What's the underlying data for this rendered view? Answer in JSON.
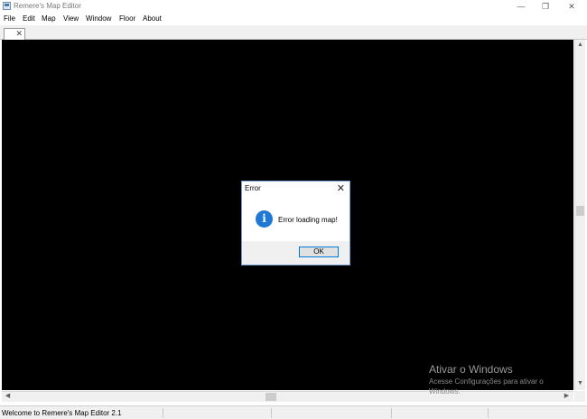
{
  "window": {
    "title": "Remere's Map Editor",
    "controls": {
      "minimize": "—",
      "maximize": "❐",
      "close": "✕"
    }
  },
  "menubar": {
    "items": [
      "File",
      "Edit",
      "Map",
      "View",
      "Window",
      "Floor",
      "About"
    ]
  },
  "tabs": [
    {
      "label": "",
      "close_icon": "✕"
    }
  ],
  "dialog": {
    "title": "Error",
    "close_icon": "✕",
    "icon": "info-icon",
    "icon_glyph": "i",
    "message": "Error loading map!",
    "ok_label": "OK"
  },
  "scrollbars": {
    "up": "▲",
    "down": "▼",
    "left": "◀",
    "right": "▶"
  },
  "statusbar": {
    "text": "Welcome to Remere's Map Editor 2.1"
  },
  "watermark": {
    "title": "Ativar o Windows",
    "line1": "Acesse Configurações para ativar o",
    "line2": "Windows."
  },
  "colors": {
    "canvas": "#000000",
    "dialog_border": "#6f9bd1",
    "info_icon": "#1e78d4",
    "button_focus": "#0078d7"
  }
}
